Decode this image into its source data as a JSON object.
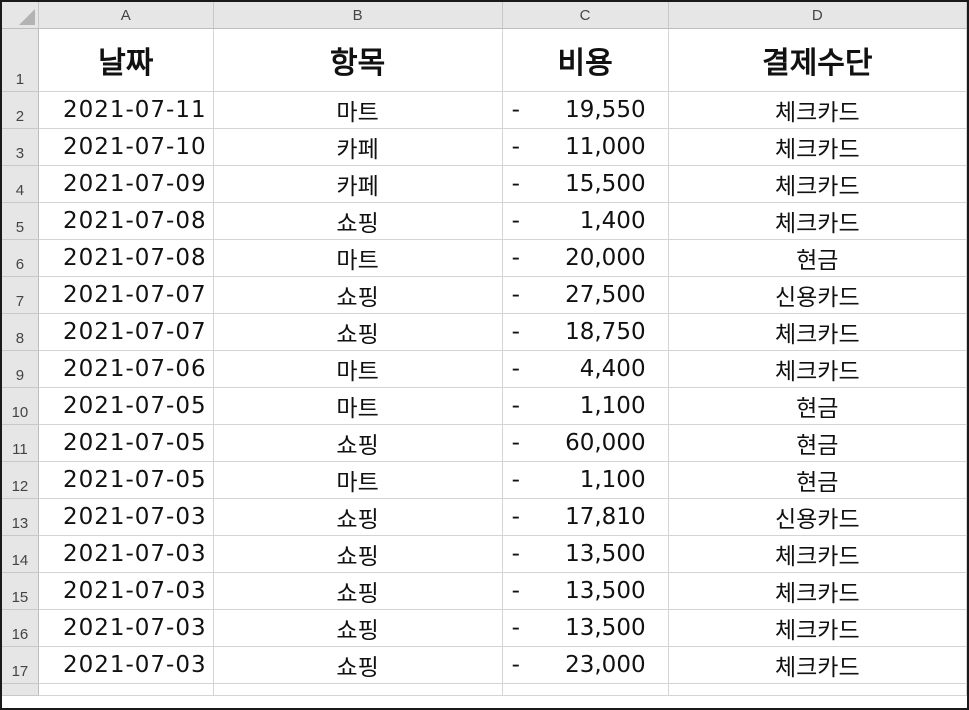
{
  "columns": [
    "A",
    "B",
    "C",
    "D"
  ],
  "headers": {
    "date": "날짜",
    "item": "항목",
    "cost": "비용",
    "payment": "결제수단"
  },
  "rows": [
    {
      "num": "2",
      "date": "2021-07-11",
      "item": "마트",
      "cost": "19,550",
      "payment": "체크카드"
    },
    {
      "num": "3",
      "date": "2021-07-10",
      "item": "카페",
      "cost": "11,000",
      "payment": "체크카드"
    },
    {
      "num": "4",
      "date": "2021-07-09",
      "item": "카페",
      "cost": "15,500",
      "payment": "체크카드"
    },
    {
      "num": "5",
      "date": "2021-07-08",
      "item": "쇼핑",
      "cost": "1,400",
      "payment": "체크카드"
    },
    {
      "num": "6",
      "date": "2021-07-08",
      "item": "마트",
      "cost": "20,000",
      "payment": "현금"
    },
    {
      "num": "7",
      "date": "2021-07-07",
      "item": "쇼핑",
      "cost": "27,500",
      "payment": "신용카드"
    },
    {
      "num": "8",
      "date": "2021-07-07",
      "item": "쇼핑",
      "cost": "18,750",
      "payment": "체크카드"
    },
    {
      "num": "9",
      "date": "2021-07-06",
      "item": "마트",
      "cost": "4,400",
      "payment": "체크카드"
    },
    {
      "num": "10",
      "date": "2021-07-05",
      "item": "마트",
      "cost": "1,100",
      "payment": "현금"
    },
    {
      "num": "11",
      "date": "2021-07-05",
      "item": "쇼핑",
      "cost": "60,000",
      "payment": "현금"
    },
    {
      "num": "12",
      "date": "2021-07-05",
      "item": "마트",
      "cost": "1,100",
      "payment": "현금"
    },
    {
      "num": "13",
      "date": "2021-07-03",
      "item": "쇼핑",
      "cost": "17,810",
      "payment": "신용카드"
    },
    {
      "num": "14",
      "date": "2021-07-03",
      "item": "쇼핑",
      "cost": "13,500",
      "payment": "체크카드"
    },
    {
      "num": "15",
      "date": "2021-07-03",
      "item": "쇼핑",
      "cost": "13,500",
      "payment": "체크카드"
    },
    {
      "num": "16",
      "date": "2021-07-03",
      "item": "쇼핑",
      "cost": "13,500",
      "payment": "체크카드"
    },
    {
      "num": "17",
      "date": "2021-07-03",
      "item": "쇼핑",
      "cost": "23,000",
      "payment": "체크카드"
    }
  ],
  "cost_prefix": "-",
  "colors": {
    "header_bg": "#e6e6e6",
    "grid": "#d4d4d4",
    "text": "#111111"
  }
}
